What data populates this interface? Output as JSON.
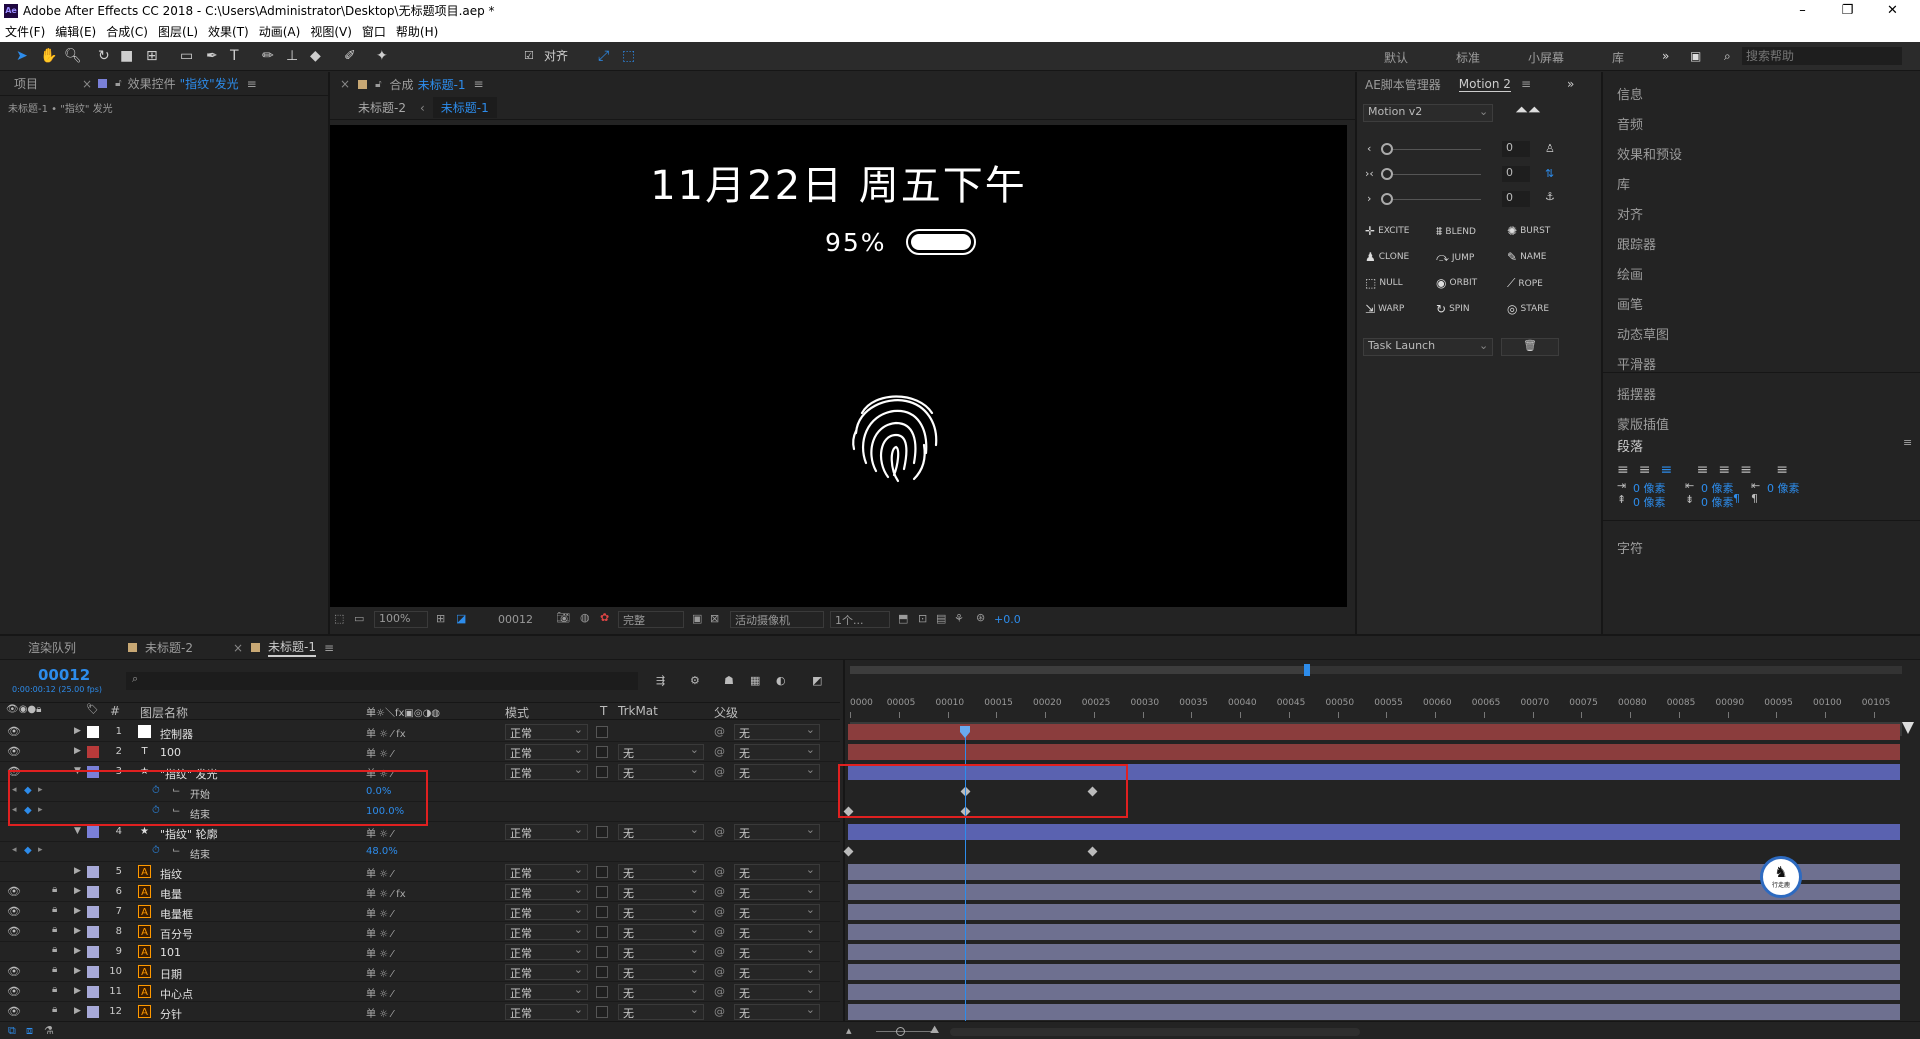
{
  "window": {
    "app_badge": "Ae",
    "title": "Adobe After Effects CC 2018 - C:\\Users\\Administrator\\Desktop\\无标题项目.aep *",
    "controls": [
      "–",
      "❐",
      "✕"
    ]
  },
  "menu": [
    "文件(F)",
    "编辑(E)",
    "合成(C)",
    "图层(L)",
    "效果(T)",
    "动画(A)",
    "视图(V)",
    "窗口",
    "帮助(H)"
  ],
  "toolbar": {
    "align_label": "对齐",
    "workspaces": [
      "默认",
      "标准",
      "小屏幕",
      "库"
    ],
    "more": "»",
    "search_placeholder": "搜索帮助"
  },
  "left_panel": {
    "tab_project": "项目",
    "tab_effects_prefix": "效果控件",
    "tab_effects_name": "\"指纹\"发光",
    "breadcrumb": "未标题-1 • \"指纹\" 发光"
  },
  "comp_panel": {
    "tab_prefix": "合成",
    "tab_name": "未标题-1",
    "nav_items": [
      "未标题-2",
      "未标题-1"
    ]
  },
  "canvas": {
    "date_text": "11月22日 周五下午",
    "battery_text": "95%"
  },
  "viewer_bar": {
    "zoom": "100%",
    "frame": "00012",
    "quality": "完整",
    "camera": "活动摄像机",
    "views": "1个...",
    "exposure": "+0.0"
  },
  "motion_panel": {
    "tab_manager": "AE脚本管理器",
    "tab_motion": "Motion 2",
    "preset": "Motion v2",
    "slider_values": [
      "0",
      "0",
      "0"
    ],
    "buttons": [
      {
        "icon": "✛",
        "label": "EXCITE"
      },
      {
        "icon": "⩩",
        "label": "BLEND"
      },
      {
        "icon": "✺",
        "label": "BURST"
      },
      {
        "icon": "♟",
        "label": "CLONE"
      },
      {
        "icon": "⤼",
        "label": "JUMP"
      },
      {
        "icon": "✎",
        "label": "NAME"
      },
      {
        "icon": "⬚",
        "label": "NULL"
      },
      {
        "icon": "◉",
        "label": "ORBIT"
      },
      {
        "icon": "⟋",
        "label": "ROPE"
      },
      {
        "icon": "⇲",
        "label": "WARP"
      },
      {
        "icon": "↻",
        "label": "SPIN"
      },
      {
        "icon": "◎",
        "label": "STARE"
      }
    ],
    "task": "Task Launch"
  },
  "right_panel": {
    "items": [
      "信息",
      "音频",
      "效果和预设",
      "库",
      "对齐",
      "跟踪器",
      "绘画",
      "画笔",
      "动态草图",
      "平滑器",
      "摇摆器",
      "蒙版插值"
    ],
    "paragraph_title": "段落",
    "paragraph_values": [
      "0 像素",
      "0 像素",
      "0 像素",
      "0 像素",
      "0 像素"
    ],
    "character_title": "字符"
  },
  "timeline": {
    "tabs": [
      "渲染队列",
      "未标题-2",
      "未标题-1"
    ],
    "timecode": "00012",
    "timecode_sub": "0:00:00:12 (25.00 fps)",
    "col_layer_name": "图层名称",
    "col_mode": "模式",
    "col_t": "T",
    "col_trkmat": "TrkMat",
    "col_parent": "父级",
    "ruler": [
      "0000",
      "00005",
      "00010",
      "00015",
      "00020",
      "00025",
      "00030",
      "00035",
      "00040",
      "00045",
      "00050",
      "00055",
      "00060",
      "00065",
      "00070",
      "00075",
      "00080",
      "00085",
      "00090",
      "00095",
      "00100",
      "00105"
    ],
    "playhead_frame": 12,
    "rows": [
      {
        "kind": "layer",
        "num": "1",
        "name": "控制器",
        "color": "#ffffff",
        "icon": "solid",
        "mode": "正常",
        "trkmat": "",
        "parent": "无",
        "eye": true,
        "lock": false,
        "bar": "#8b3d3d",
        "fx": true
      },
      {
        "kind": "layer",
        "num": "2",
        "name": "100",
        "color": "#b83a3a",
        "icon": "T",
        "mode": "正常",
        "trkmat": "无",
        "parent": "无",
        "eye": true,
        "lock": false,
        "bar": "#8b3d3d",
        "fx": false
      },
      {
        "kind": "layer",
        "num": "3",
        "name": "\"指纹\" 发光",
        "color": "#7a80d8",
        "icon": "★",
        "mode": "正常",
        "trkmat": "无",
        "parent": "无",
        "eye": true,
        "lock": false,
        "bar": "#5a62b0",
        "open": true
      },
      {
        "kind": "prop",
        "name": "开始",
        "value": "0.0%"
      },
      {
        "kind": "prop",
        "name": "结束",
        "value": "100.0%"
      },
      {
        "kind": "layer",
        "num": "4",
        "name": "\"指纹\" 轮廓",
        "color": "#7a80d8",
        "icon": "★",
        "mode": "正常",
        "trkmat": "无",
        "parent": "无",
        "eye": false,
        "lock": false,
        "bar": "#5a62b0",
        "open": true
      },
      {
        "kind": "prop",
        "name": "结束",
        "value": "48.0%"
      },
      {
        "kind": "layer",
        "num": "5",
        "name": "指纹",
        "color": "#a7a9d8",
        "icon": "Ai",
        "mode": "正常",
        "trkmat": "无",
        "parent": "无",
        "eye": false,
        "lock": false,
        "bar": "#6e7090"
      },
      {
        "kind": "layer",
        "num": "6",
        "name": "电量",
        "color": "#a7a9d8",
        "icon": "Ai",
        "mode": "正常",
        "trkmat": "无",
        "parent": "无",
        "eye": true,
        "lock": true,
        "bar": "#6e7090",
        "fx": true
      },
      {
        "kind": "layer",
        "num": "7",
        "name": "电量框",
        "color": "#a7a9d8",
        "icon": "Ai",
        "mode": "正常",
        "trkmat": "无",
        "parent": "无",
        "eye": true,
        "lock": true,
        "bar": "#6e7090"
      },
      {
        "kind": "layer",
        "num": "8",
        "name": "百分号",
        "color": "#a7a9d8",
        "icon": "Ai",
        "mode": "正常",
        "trkmat": "无",
        "parent": "无",
        "eye": true,
        "lock": true,
        "bar": "#6e7090"
      },
      {
        "kind": "layer",
        "num": "9",
        "name": "101",
        "color": "#a7a9d8",
        "icon": "Ai",
        "mode": "正常",
        "trkmat": "无",
        "parent": "无",
        "eye": false,
        "lock": true,
        "bar": "#6e7090"
      },
      {
        "kind": "layer",
        "num": "10",
        "name": "日期",
        "color": "#a7a9d8",
        "icon": "Ai",
        "mode": "正常",
        "trkmat": "无",
        "parent": "无",
        "eye": true,
        "lock": true,
        "bar": "#6e7090"
      },
      {
        "kind": "layer",
        "num": "11",
        "name": "中心点",
        "color": "#a7a9d8",
        "icon": "Ai",
        "mode": "正常",
        "trkmat": "无",
        "parent": "无",
        "eye": true,
        "lock": true,
        "bar": "#6e7090"
      },
      {
        "kind": "layer",
        "num": "12",
        "name": "分针",
        "color": "#a7a9d8",
        "icon": "Ai",
        "mode": "正常",
        "trkmat": "无",
        "parent": "无",
        "eye": true,
        "lock": true,
        "bar": "#6e7090"
      }
    ],
    "keyframes": [
      {
        "row": 3,
        "frames": [
          12,
          25
        ]
      },
      {
        "row": 4,
        "frames": [
          0,
          12
        ]
      },
      {
        "row": 6,
        "frames": [
          0,
          25
        ]
      }
    ],
    "watermark": "行走鹿"
  },
  "colors": {
    "accent": "#2d8ceb",
    "panel": "#232323",
    "highlight_box": "#e02020"
  }
}
